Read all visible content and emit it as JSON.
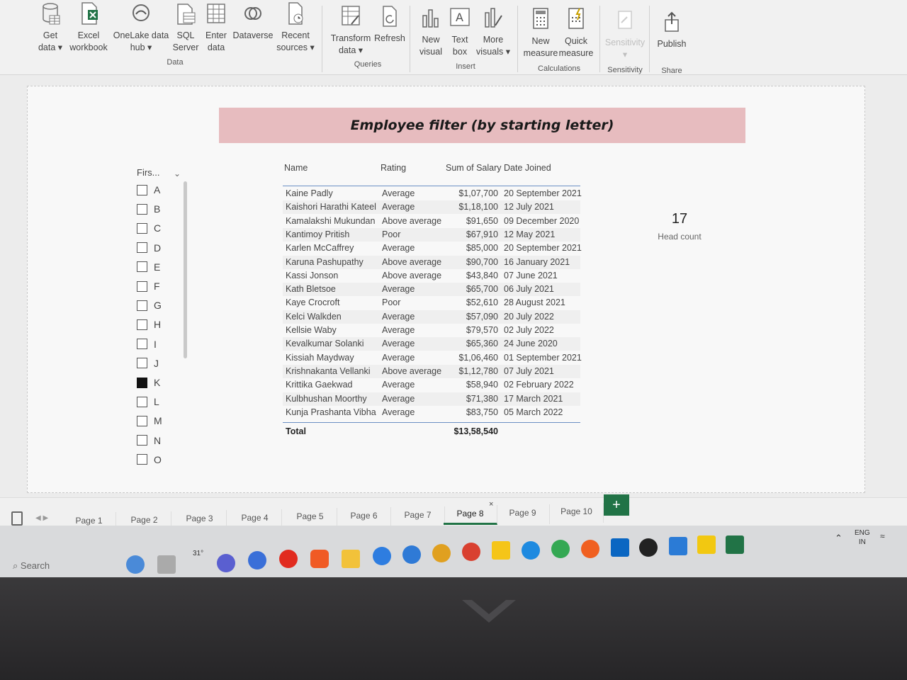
{
  "ribbon": {
    "groups": [
      {
        "label": "Data"
      },
      {
        "label": "Queries"
      },
      {
        "label": "Insert"
      },
      {
        "label": "Calculations"
      },
      {
        "label": "Sensitivity"
      },
      {
        "label": "Share"
      }
    ],
    "buttons": {
      "get_data": [
        "Get",
        "data ▾"
      ],
      "excel": [
        "Excel",
        "workbook"
      ],
      "onelake": [
        "OneLake data",
        "hub ▾"
      ],
      "sql": [
        "SQL",
        "Server"
      ],
      "enter": [
        "Enter",
        "data"
      ],
      "dataverse": [
        "Dataverse",
        ""
      ],
      "recent": [
        "Recent",
        "sources ▾"
      ],
      "transform": [
        "Transform",
        "data ▾"
      ],
      "refresh": [
        "Refresh",
        ""
      ],
      "new_visual": [
        "New",
        "visual"
      ],
      "text_box": [
        "Text",
        "box"
      ],
      "more_visuals": [
        "More",
        "visuals ▾"
      ],
      "new_measure": [
        "New",
        "measure"
      ],
      "quick_measure": [
        "Quick",
        "measure"
      ],
      "sensitivity": [
        "Sensitivity",
        "▾"
      ],
      "publish": [
        "Publish",
        ""
      ]
    }
  },
  "report": {
    "title": "Employee filter (by starting letter)",
    "slicer": {
      "header": "Firs...",
      "items": [
        {
          "letter": "A",
          "checked": false
        },
        {
          "letter": "B",
          "checked": false
        },
        {
          "letter": "C",
          "checked": false
        },
        {
          "letter": "D",
          "checked": false
        },
        {
          "letter": "E",
          "checked": false
        },
        {
          "letter": "F",
          "checked": false
        },
        {
          "letter": "G",
          "checked": false
        },
        {
          "letter": "H",
          "checked": false
        },
        {
          "letter": "I",
          "checked": false
        },
        {
          "letter": "J",
          "checked": false
        },
        {
          "letter": "K",
          "checked": true
        },
        {
          "letter": "L",
          "checked": false
        },
        {
          "letter": "M",
          "checked": false
        },
        {
          "letter": "N",
          "checked": false
        },
        {
          "letter": "O",
          "checked": false
        }
      ]
    },
    "table": {
      "columns": [
        "Name",
        "Rating",
        "Sum of Salary",
        "Date Joined"
      ],
      "rows": [
        [
          "Kaine Padly",
          "Average",
          "$1,07,700",
          "20 September 2021"
        ],
        [
          "Kaishori Harathi Kateel",
          "Average",
          "$1,18,100",
          "12 July 2021"
        ],
        [
          "Kamalakshi Mukundan",
          "Above average",
          "$91,650",
          "09 December 2020"
        ],
        [
          "Kantimoy Pritish",
          "Poor",
          "$67,910",
          "12 May 2021"
        ],
        [
          "Karlen McCaffrey",
          "Average",
          "$85,000",
          "20 September 2021"
        ],
        [
          "Karuna Pashupathy",
          "Above average",
          "$90,700",
          "16 January 2021"
        ],
        [
          "Kassi Jonson",
          "Above average",
          "$43,840",
          "07 June 2021"
        ],
        [
          "Kath Bletsoe",
          "Average",
          "$65,700",
          "06 July 2021"
        ],
        [
          "Kaye Crocroft",
          "Poor",
          "$52,610",
          "28 August 2021"
        ],
        [
          "Kelci Walkden",
          "Average",
          "$57,090",
          "20 July 2022"
        ],
        [
          "Kellsie Waby",
          "Average",
          "$79,570",
          "02 July 2022"
        ],
        [
          "Kevalkumar Solanki",
          "Average",
          "$65,360",
          "24 June 2020"
        ],
        [
          "Kissiah Maydway",
          "Average",
          "$1,06,460",
          "01 September 2021"
        ],
        [
          "Krishnakanta Vellanki",
          "Above average",
          "$1,12,780",
          "07 July 2021"
        ],
        [
          "Krittika Gaekwad",
          "Average",
          "$58,940",
          "02 February 2022"
        ],
        [
          "Kulbhushan Moorthy",
          "Average",
          "$71,380",
          "17 March 2021"
        ],
        [
          "Kunja Prashanta Vibha",
          "Average",
          "$83,750",
          "05 March 2022"
        ]
      ],
      "total_label": "Total",
      "total_salary": "$13,58,540"
    },
    "kpi": {
      "value": "17",
      "label": "Head count"
    }
  },
  "pages": {
    "tabs": [
      "Page 1",
      "Page 2",
      "Page 3",
      "Page 4",
      "Page 5",
      "Page 6",
      "Page 7",
      "Page 8",
      "Page 9",
      "Page 10"
    ],
    "active_index": 7,
    "add_label": "+",
    "close_label": "×"
  },
  "taskbar": {
    "search_label": "Search",
    "weather": "31°",
    "lang_top": "ENG",
    "lang_bottom": "IN"
  },
  "colors": {
    "banner": "#e7bcbf",
    "accent": "#217346",
    "table_rule": "#6a8ec4"
  }
}
